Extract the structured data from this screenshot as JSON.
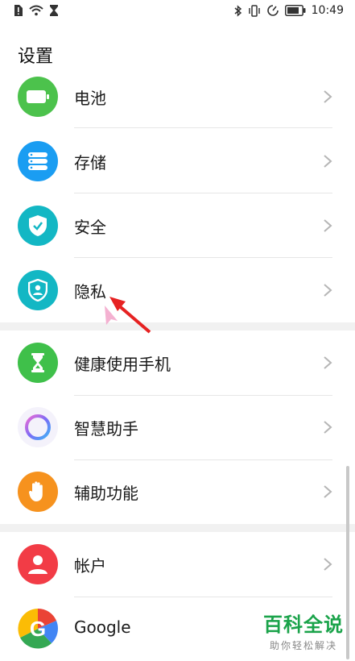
{
  "status_bar": {
    "time": "10:49",
    "icons_left": [
      "sim-alert-icon",
      "wifi-icon",
      "hourglass-icon"
    ],
    "icons_right": [
      "bluetooth-icon",
      "vibrate-icon",
      "data-saver-icon",
      "battery-icon"
    ]
  },
  "page": {
    "title": "设置"
  },
  "settings": {
    "battery": {
      "label": "电池",
      "icon": "battery-icon",
      "color": "#4cc24c"
    },
    "storage": {
      "label": "存储",
      "icon": "storage-icon",
      "color": "#1a9df2"
    },
    "security": {
      "label": "安全",
      "icon": "shield-check-icon",
      "color": "#13b7c4"
    },
    "privacy": {
      "label": "隐私",
      "icon": "privacy-shield-icon",
      "color": "#13b7c4"
    },
    "digital_health": {
      "label": "健康使用手机",
      "icon": "hourglass-icon",
      "color": "#3fc04a"
    },
    "assistant": {
      "label": "智慧助手",
      "icon": "assistant-ring-icon",
      "color": "#8a6cf0"
    },
    "accessibility": {
      "label": "辅助功能",
      "icon": "hand-icon",
      "color": "#f6921e"
    },
    "accounts": {
      "label": "帐户",
      "icon": "user-icon",
      "color": "#f23c46"
    },
    "google": {
      "label": "Google",
      "icon": "google-icon",
      "color": "#4285f4"
    }
  },
  "watermark": {
    "title": "百科全说",
    "subtitle": "助你轻松解决"
  }
}
